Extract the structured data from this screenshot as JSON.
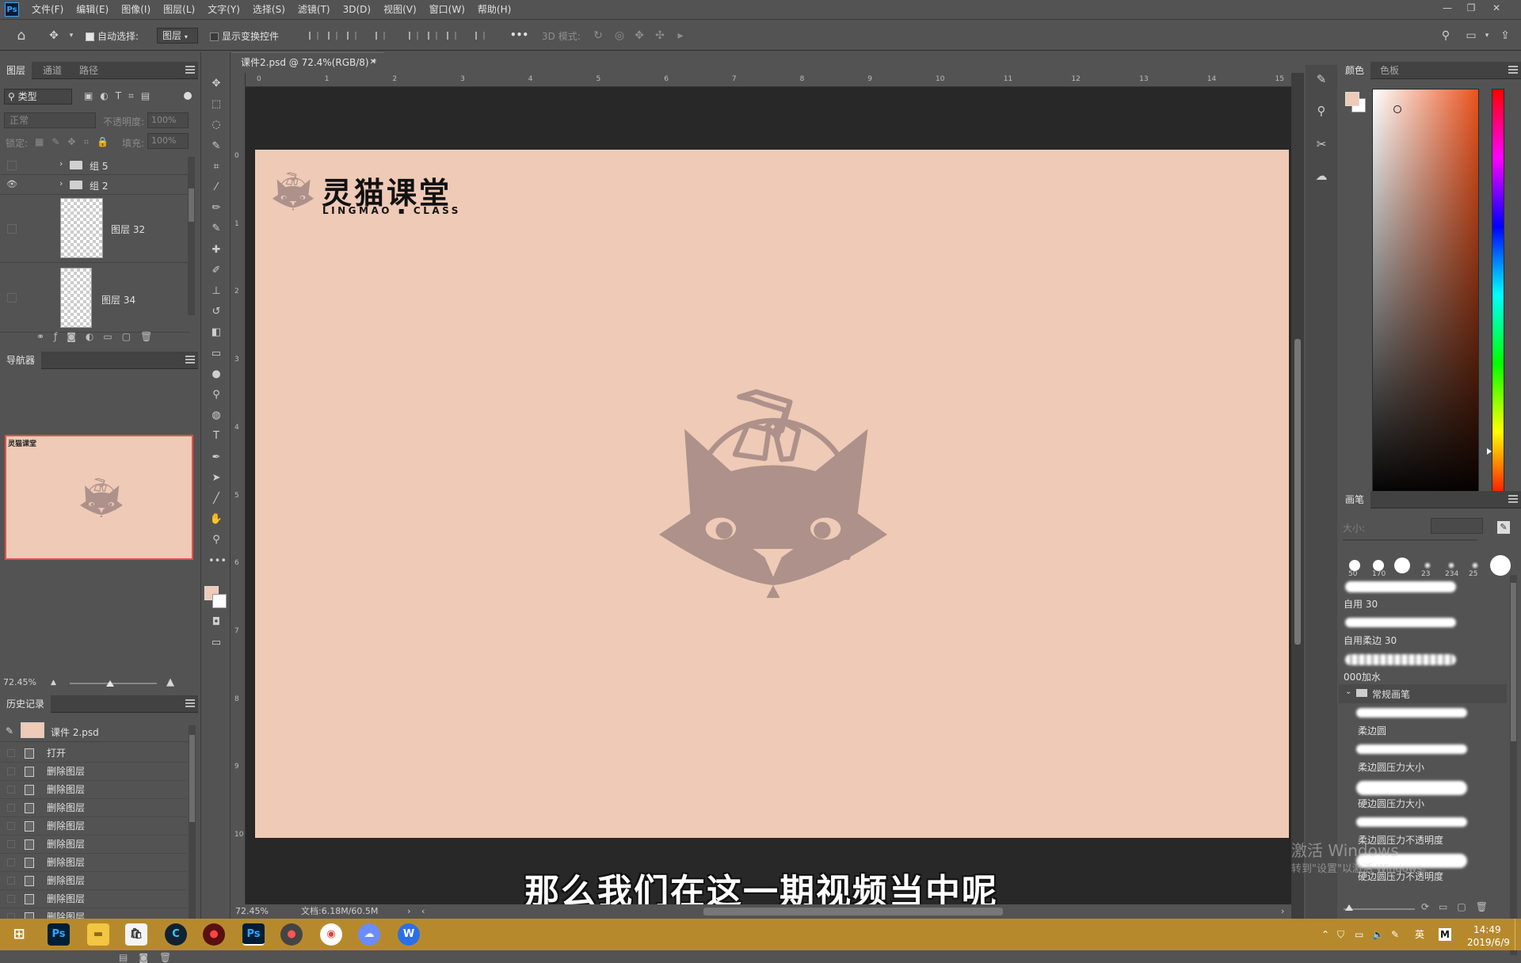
{
  "app": {
    "logo": "Ps"
  },
  "menu": [
    "文件(F)",
    "编辑(E)",
    "图像(I)",
    "图层(L)",
    "文字(Y)",
    "选择(S)",
    "滤镜(T)",
    "3D(D)",
    "视图(V)",
    "窗口(W)",
    "帮助(H)"
  ],
  "options": {
    "auto_select_label": "自动选择:",
    "auto_select_value": "图层",
    "show_transform_label": "显示变换控件",
    "mode_3d_label": "3D 模式:",
    "more": "•••"
  },
  "layers_panel": {
    "tabs": [
      "图层",
      "通道",
      "路径"
    ],
    "filter_label": "类型",
    "blend_mode": "正常",
    "opacity_label": "不透明度:",
    "opacity_value": "100%",
    "lock_label": "锁定:",
    "fill_label": "填充:",
    "fill_value": "100%",
    "layers": [
      {
        "name": "组 5",
        "visible": false
      },
      {
        "name": "组 2",
        "visible": true
      },
      {
        "name": "图层 32",
        "visible": false
      },
      {
        "name": "图层 34",
        "visible": false
      }
    ]
  },
  "navigator": {
    "title": "导航器",
    "zoom": "72.45%"
  },
  "history": {
    "title": "历史记录",
    "snapshot": "课件 2.psd",
    "items": [
      "打开",
      "删除图层",
      "删除图层",
      "删除图层",
      "删除图层",
      "删除图层",
      "删除图层",
      "删除图层",
      "删除图层",
      "删除图层",
      "删除图层"
    ]
  },
  "document": {
    "tab_title": "课件2.psd @ 72.4%(RGB/8) *",
    "ruler_top": [
      "0",
      "1",
      "2",
      "3",
      "4",
      "5",
      "6",
      "7",
      "8",
      "9",
      "10",
      "11",
      "12",
      "13",
      "14",
      "15"
    ],
    "ruler_left": [
      "0",
      "1",
      "2",
      "3",
      "4",
      "5",
      "6",
      "7",
      "8",
      "9",
      "10"
    ],
    "canvas_color": "#efcab6",
    "logo_text_cn": "灵猫课堂",
    "logo_text_en": "LINGMAO ▪ CLASS",
    "subtitle": "那么我们在这一期视频当中呢"
  },
  "status": {
    "zoom": "72.45%",
    "doc_size": "文档:6.18M/60.5M"
  },
  "color_panel": {
    "tabs": [
      "颜色",
      "色板"
    ],
    "foreground": "#efcab6",
    "background": "#ffffff"
  },
  "brush_panel": {
    "title": "画笔",
    "size_label": "大小:",
    "presets": [
      "50",
      "170",
      "",
      "23",
      "234",
      "25",
      ""
    ],
    "brushes": [
      "自用 30",
      "自用柔边 30",
      "000加水"
    ],
    "group": "常规画笔",
    "group_items": [
      "柔边圆",
      "柔边圆压力大小",
      "硬边圆压力大小",
      "柔边圆压力不透明度",
      "硬边圆压力不透明度"
    ]
  },
  "watermark": {
    "line1": "激活 Windows",
    "line2": "转到\"设置\"以激活 Windows。"
  },
  "taskbar": {
    "time": "14:49",
    "date": "2019/6/9",
    "ime": "英",
    "letter": "M"
  }
}
